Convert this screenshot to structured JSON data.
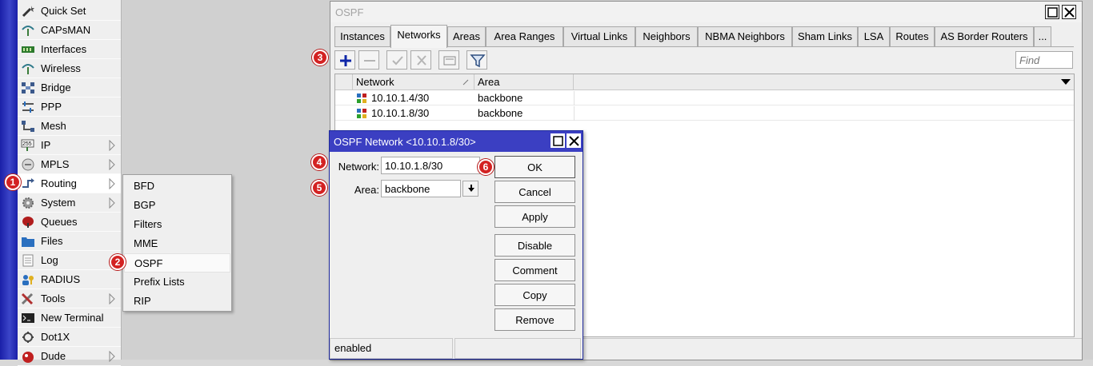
{
  "main_menu": {
    "items": [
      {
        "label": "Quick Set",
        "icon": "wand-icon"
      },
      {
        "label": "CAPsMAN",
        "icon": "antenna-icon"
      },
      {
        "label": "Interfaces",
        "icon": "interfaces-icon"
      },
      {
        "label": "Wireless",
        "icon": "wireless-icon"
      },
      {
        "label": "Bridge",
        "icon": "bridge-icon"
      },
      {
        "label": "PPP",
        "icon": "ppp-icon"
      },
      {
        "label": "Mesh",
        "icon": "mesh-icon"
      },
      {
        "label": "IP",
        "icon": "ip-icon"
      },
      {
        "label": "MPLS",
        "icon": "mpls-icon"
      },
      {
        "label": "Routing",
        "icon": "routing-icon"
      },
      {
        "label": "System",
        "icon": "system-gear-icon"
      },
      {
        "label": "Queues",
        "icon": "queues-icon"
      },
      {
        "label": "Files",
        "icon": "folder-icon"
      },
      {
        "label": "Log",
        "icon": "log-icon"
      },
      {
        "label": "RADIUS",
        "icon": "radius-icon"
      },
      {
        "label": "Tools",
        "icon": "tools-icon"
      },
      {
        "label": "New Terminal",
        "icon": "terminal-icon"
      },
      {
        "label": "Dot1X",
        "icon": "dot1x-icon"
      },
      {
        "label": "Dude",
        "icon": "dude-icon"
      }
    ]
  },
  "routing_submenu": {
    "items": [
      "BFD",
      "BGP",
      "Filters",
      "MME",
      "OSPF",
      "Prefix Lists",
      "RIP"
    ],
    "selected": "OSPF"
  },
  "steps": [
    "1",
    "2",
    "3",
    "4",
    "5",
    "6"
  ],
  "ospf_window": {
    "title": "OSPF",
    "tabs": [
      "Instances",
      "Networks",
      "Areas",
      "Area Ranges",
      "Virtual Links",
      "Neighbors",
      "NBMA Neighbors",
      "Sham Links",
      "LSA",
      "Routes",
      "AS Border Routers",
      "..."
    ],
    "active_tab": "Networks",
    "toolbar": {
      "add": "plus-icon",
      "remove": "minus-icon",
      "enable": "check-icon",
      "disable": "cross-icon",
      "comment": "comment-icon",
      "filter": "filter-icon"
    },
    "find_placeholder": "Find",
    "columns": [
      "Network",
      "Area"
    ],
    "rows": [
      {
        "network": "10.10.1.4/30",
        "area": "backbone"
      },
      {
        "network": "10.10.1.8/30",
        "area": "backbone"
      }
    ]
  },
  "dialog": {
    "title": "OSPF Network <10.10.1.8/30>",
    "network_label": "Network:",
    "network_value": "10.10.1.8/30",
    "area_label": "Area:",
    "area_value": "backbone",
    "buttons": {
      "ok": "OK",
      "cancel": "Cancel",
      "apply": "Apply",
      "disable": "Disable",
      "comment": "Comment",
      "copy": "Copy",
      "remove": "Remove"
    },
    "status": "enabled"
  },
  "colors": {
    "accent_blue": "#3b3fc2",
    "badge_red": "#d32222",
    "plus_blue": "#0f27a8"
  }
}
